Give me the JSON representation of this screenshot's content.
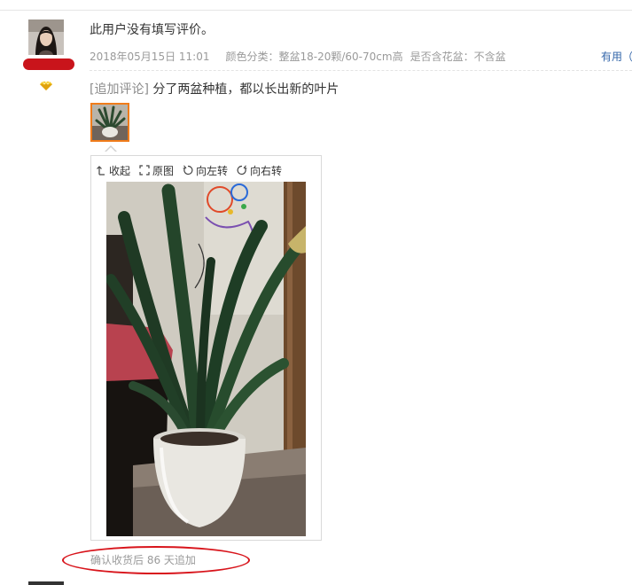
{
  "review": {
    "content": "此用户没有填写评价。",
    "date": "2018年05月15日 11:01",
    "color_label": "颜色分类：",
    "color_value": "整盆18-20颗/60-70cm高",
    "pot_label": "是否含花盆：",
    "pot_value": "不含盆",
    "useful_label": "有用（"
  },
  "append": {
    "tag": "[追加评论]",
    "text": "分了两盆种植，都以长出新的叶片"
  },
  "viewer": {
    "collapse_label": "收起",
    "original_label": "原图",
    "rotate_left_label": "向左转",
    "rotate_right_label": "向右转"
  },
  "footer": {
    "confirm_text": "确认收货后 86 天追加"
  },
  "colors": {
    "highlight_red": "#d8141b",
    "thumb_border": "#f07c1a",
    "link_blue": "#3366aa",
    "muted_gray": "#9a9a9a"
  },
  "icons": [
    "avatar-photo",
    "vip-diamond-icon",
    "collapse-icon",
    "fullscreen-icon",
    "rotate-left-icon",
    "rotate-right-icon"
  ]
}
